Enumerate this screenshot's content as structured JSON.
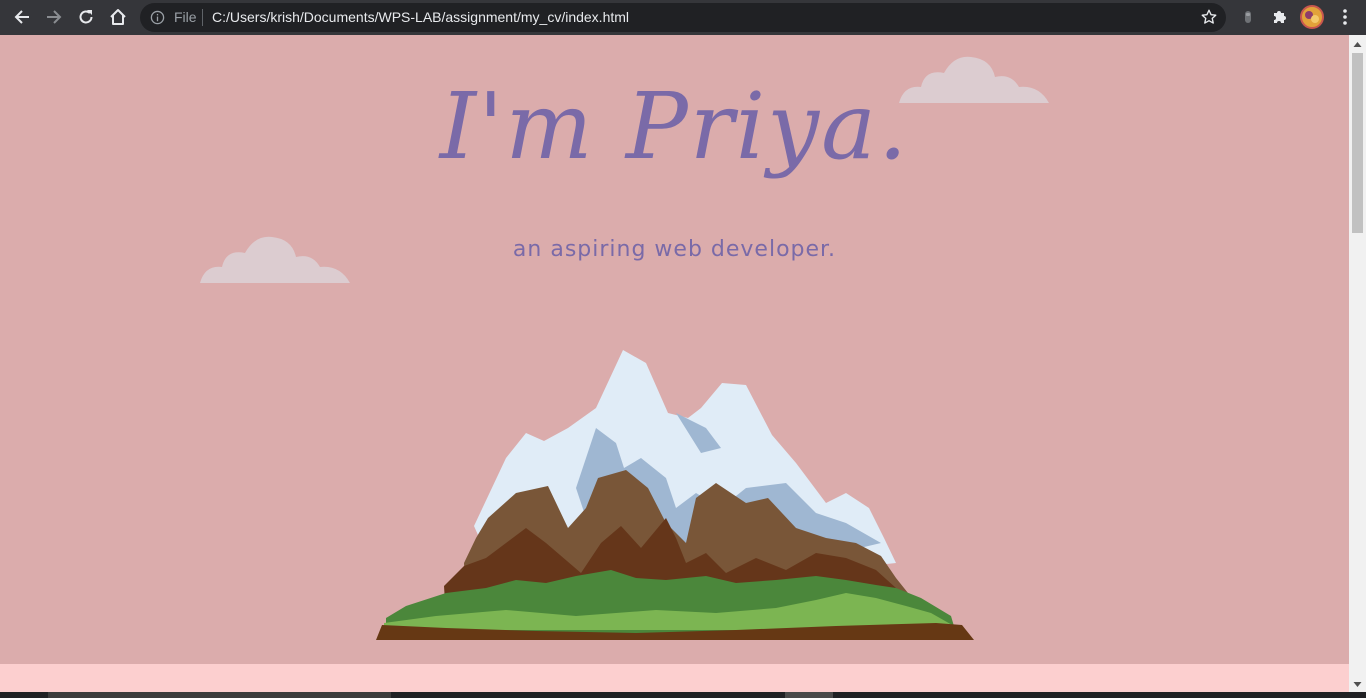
{
  "browser": {
    "scheme_label": "File",
    "url": "C:/Users/krish/Documents/WPS-LAB/assignment/my_cv/index.html",
    "icons": {
      "back": "back-arrow-icon",
      "forward": "forward-arrow-icon",
      "reload": "reload-icon",
      "home": "home-icon",
      "info": "info-icon",
      "bookmark": "star-icon",
      "extension_bar": "extension-icon",
      "extensions": "puzzle-icon",
      "profile": "avatar",
      "menu": "kebab-menu-icon"
    }
  },
  "page": {
    "title": "I'm Priya.",
    "subtitle": "an aspiring web developer.",
    "colors": {
      "background": "#dbacac",
      "text": "#7a6aa8",
      "cloud": "#dcccd0",
      "bottom_section": "#fccfcf"
    }
  }
}
